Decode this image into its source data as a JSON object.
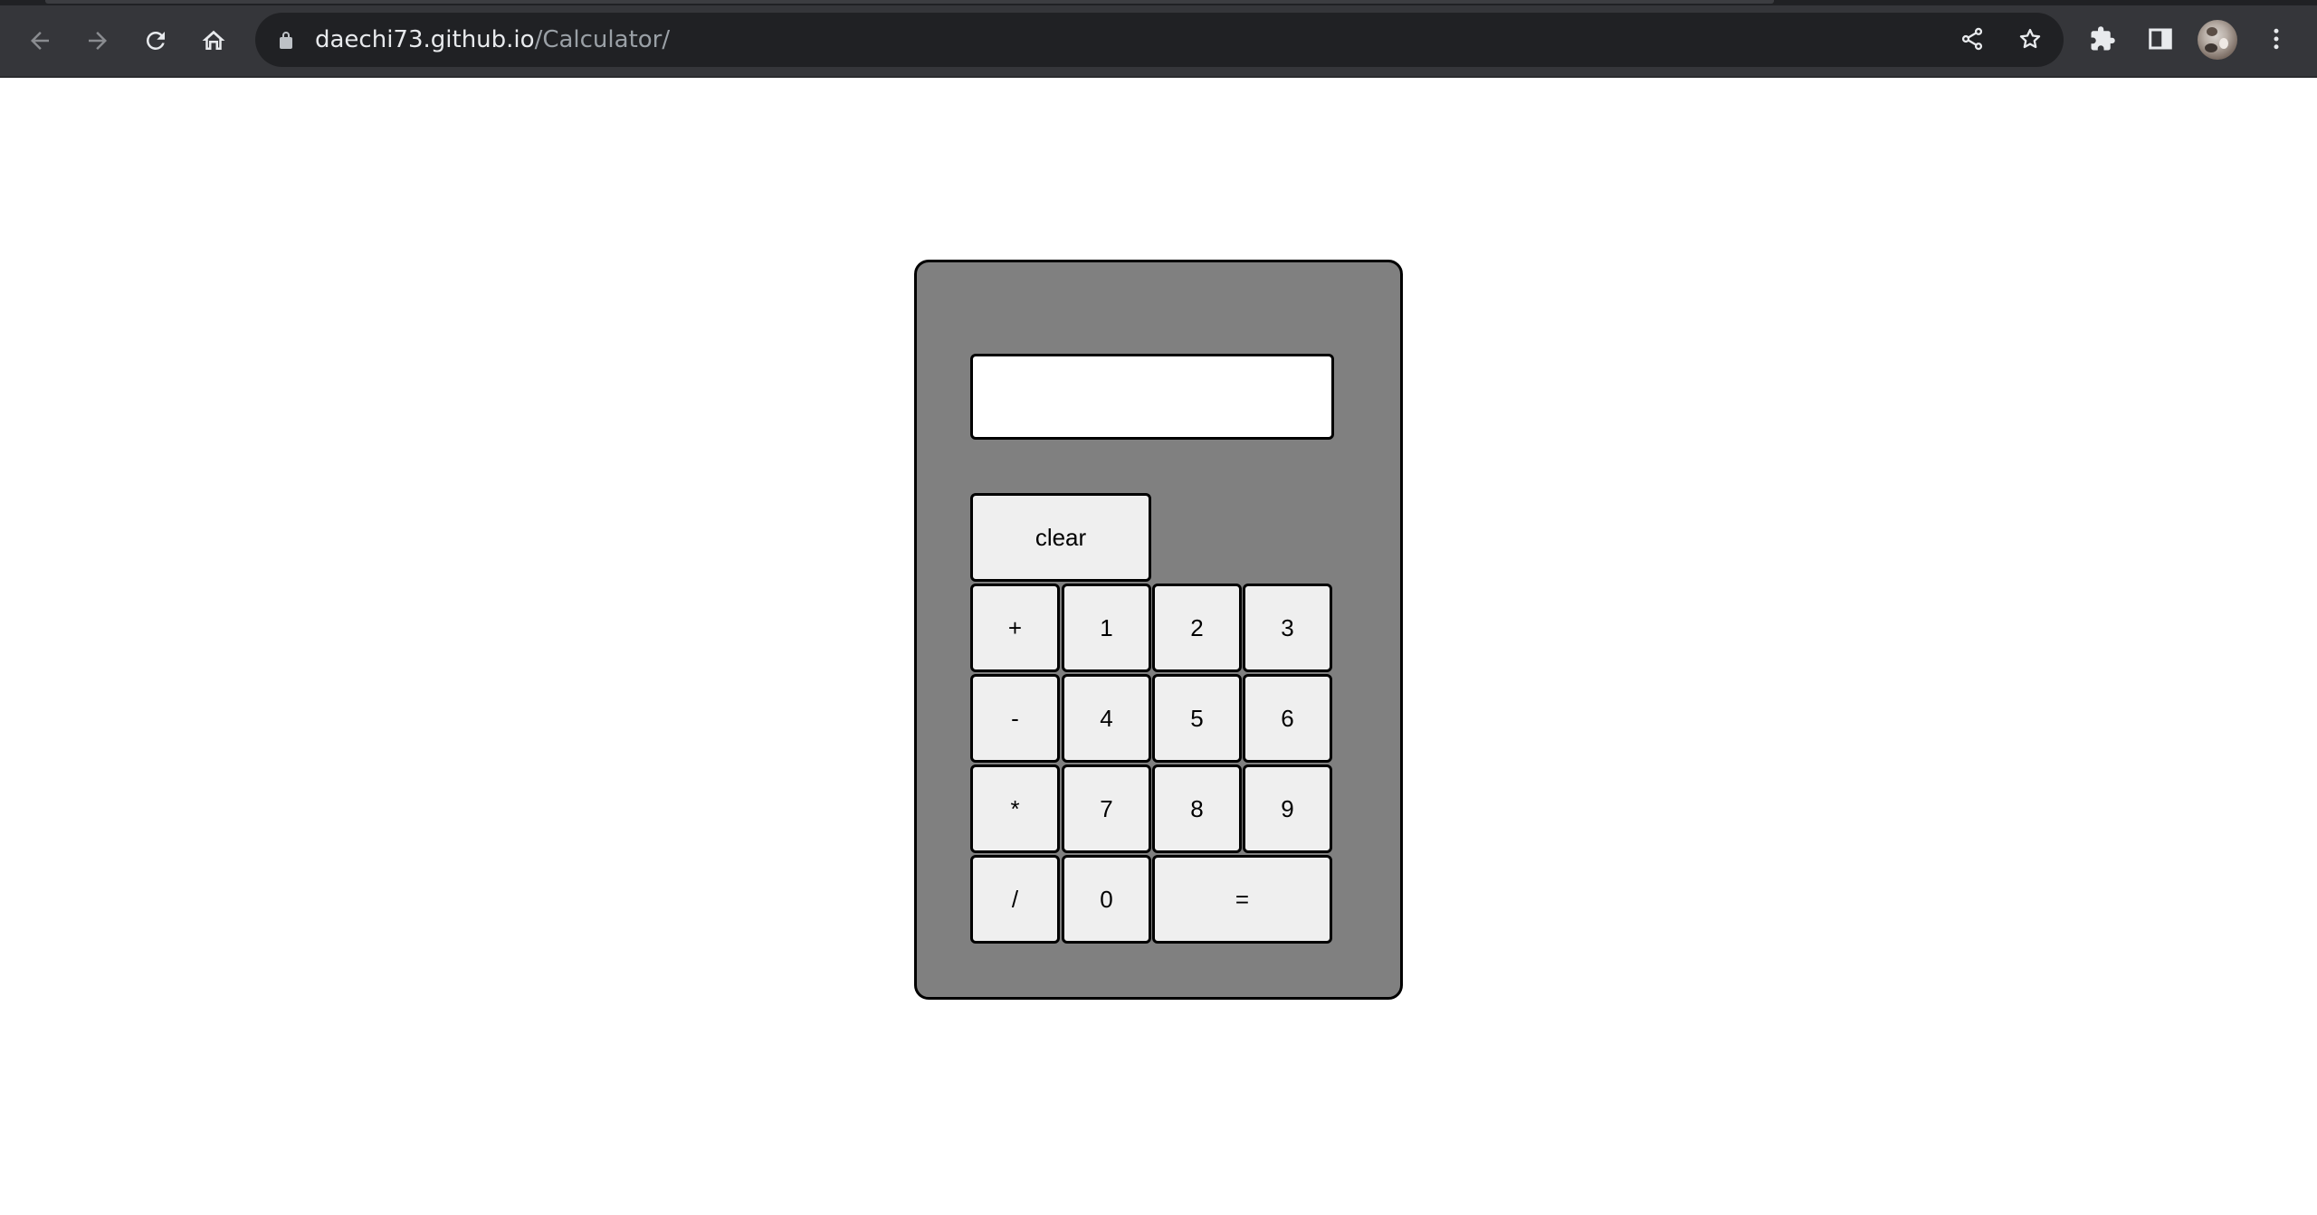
{
  "browser": {
    "url_host": "daechi73.github.io",
    "url_path": "/Calculator/",
    "icons": {
      "back": "arrow-left-icon",
      "forward": "arrow-right-icon",
      "reload": "reload-icon",
      "home": "home-icon",
      "lock": "lock-icon",
      "share": "share-icon",
      "bookmark": "star-icon",
      "extensions": "puzzle-icon",
      "side_panel": "side-panel-icon",
      "profile": "avatar",
      "menu": "kebab-menu-icon"
    }
  },
  "calculator": {
    "display_value": "",
    "buttons": {
      "clear": "clear",
      "plus": "+",
      "one": "1",
      "two": "2",
      "three": "3",
      "minus": "-",
      "four": "4",
      "five": "5",
      "six": "6",
      "multiply": "*",
      "seven": "7",
      "eight": "8",
      "nine": "9",
      "divide": "/",
      "zero": "0",
      "equals": "="
    }
  },
  "colors": {
    "chrome_background": "#35363a",
    "omnibox_background": "#202124",
    "calculator_body": "#808080",
    "key_background": "#efefef",
    "border": "#000000"
  }
}
